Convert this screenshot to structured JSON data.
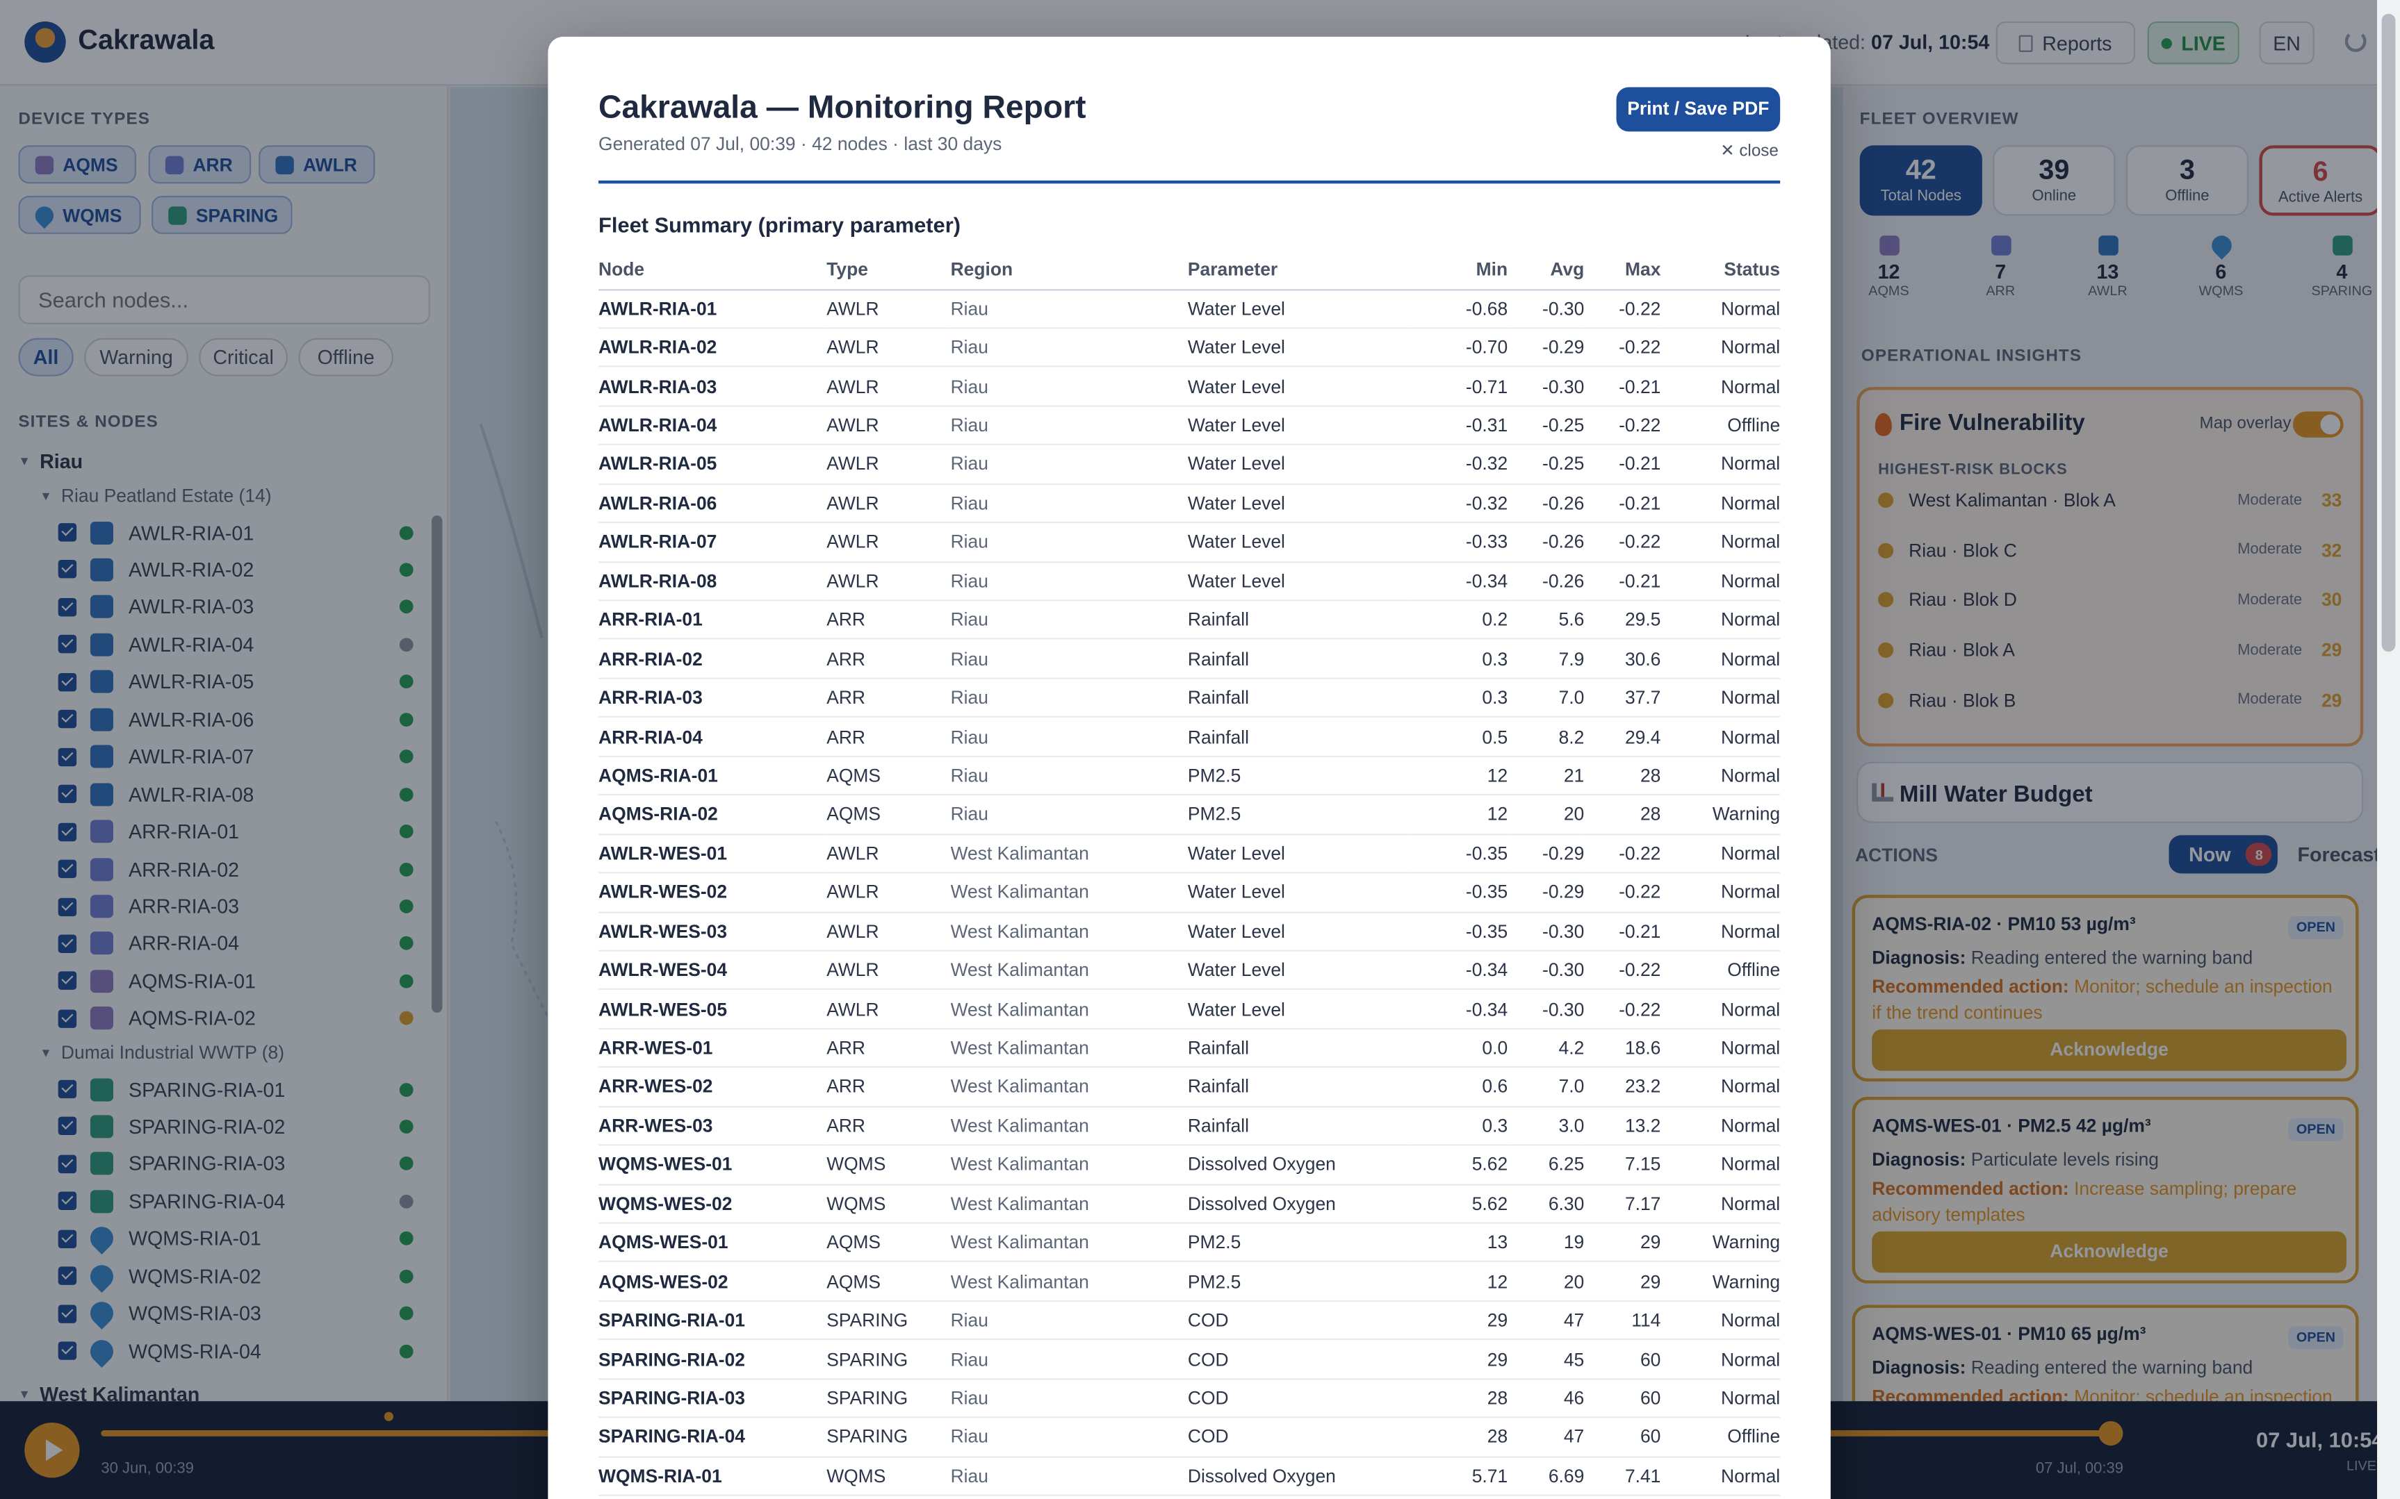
{
  "app": {
    "name": "Cakrawala",
    "last_updated_label": "Last updated:",
    "last_updated": "07 Jul, 10:54",
    "reports": "Reports",
    "live": "LIVE",
    "lang": "EN"
  },
  "left": {
    "device_types_label": "DEVICE TYPES",
    "device_types": [
      "AQMS",
      "ARR",
      "AWLR",
      "WQMS",
      "SPARING"
    ],
    "search_placeholder": "Search nodes...",
    "filters": [
      "All",
      "Warning",
      "Critical",
      "Offline"
    ],
    "tree_label": "SITES & NODES",
    "region1": "Riau",
    "site1": "Riau Peatland Estate (14)",
    "site1_nodes": [
      {
        "name": "AWLR-RIA-01",
        "type": "AWLR",
        "status": "ok"
      },
      {
        "name": "AWLR-RIA-02",
        "type": "AWLR",
        "status": "ok"
      },
      {
        "name": "AWLR-RIA-03",
        "type": "AWLR",
        "status": "ok"
      },
      {
        "name": "AWLR-RIA-04",
        "type": "AWLR",
        "status": "off"
      },
      {
        "name": "AWLR-RIA-05",
        "type": "AWLR",
        "status": "ok"
      },
      {
        "name": "AWLR-RIA-06",
        "type": "AWLR",
        "status": "ok"
      },
      {
        "name": "AWLR-RIA-07",
        "type": "AWLR",
        "status": "ok"
      },
      {
        "name": "AWLR-RIA-08",
        "type": "AWLR",
        "status": "ok"
      },
      {
        "name": "ARR-RIA-01",
        "type": "ARR",
        "status": "ok"
      },
      {
        "name": "ARR-RIA-02",
        "type": "ARR",
        "status": "ok"
      },
      {
        "name": "ARR-RIA-03",
        "type": "ARR",
        "status": "ok"
      },
      {
        "name": "ARR-RIA-04",
        "type": "ARR",
        "status": "ok"
      },
      {
        "name": "AQMS-RIA-01",
        "type": "AQMS",
        "status": "ok"
      },
      {
        "name": "AQMS-RIA-02",
        "type": "AQMS",
        "status": "warn"
      }
    ],
    "site2": "Dumai Industrial WWTP (8)",
    "site2_nodes": [
      {
        "name": "SPARING-RIA-01",
        "type": "SPARING",
        "status": "ok"
      },
      {
        "name": "SPARING-RIA-02",
        "type": "SPARING",
        "status": "ok"
      },
      {
        "name": "SPARING-RIA-03",
        "type": "SPARING",
        "status": "ok"
      },
      {
        "name": "SPARING-RIA-04",
        "type": "SPARING",
        "status": "off"
      },
      {
        "name": "WQMS-RIA-01",
        "type": "WQMS",
        "status": "ok"
      },
      {
        "name": "WQMS-RIA-02",
        "type": "WQMS",
        "status": "ok"
      },
      {
        "name": "WQMS-RIA-03",
        "type": "WQMS",
        "status": "ok"
      },
      {
        "name": "WQMS-RIA-04",
        "type": "WQMS",
        "status": "ok"
      }
    ],
    "region2": "West Kalimantan"
  },
  "right": {
    "fleet_label": "FLEET OVERVIEW",
    "tiles": [
      {
        "n": "42",
        "l": "Total Nodes"
      },
      {
        "n": "39",
        "l": "Online"
      },
      {
        "n": "3",
        "l": "Offline"
      },
      {
        "n": "6",
        "l": "Active Alerts"
      }
    ],
    "types": [
      {
        "n": "12",
        "l": "AQMS"
      },
      {
        "n": "7",
        "l": "ARR"
      },
      {
        "n": "13",
        "l": "AWLR"
      },
      {
        "n": "6",
        "l": "WQMS"
      },
      {
        "n": "4",
        "l": "SPARING"
      }
    ],
    "insights_label": "OPERATIONAL INSIGHTS",
    "fire_title": "Fire Vulnerability",
    "map_overlay": "Map overlay",
    "map_overlay_on": true,
    "risk_label": "HIGHEST-RISK BLOCKS",
    "blocks": [
      {
        "name": "West Kalimantan · Blok A",
        "level": "Moderate",
        "score": "33"
      },
      {
        "name": "Riau · Blok C",
        "level": "Moderate",
        "score": "32"
      },
      {
        "name": "Riau · Blok D",
        "level": "Moderate",
        "score": "30"
      },
      {
        "name": "Riau · Blok A",
        "level": "Moderate",
        "score": "29"
      },
      {
        "name": "Riau · Blok B",
        "level": "Moderate",
        "score": "29"
      }
    ],
    "mill_title": "Mill Water Budget",
    "actions_label": "ACTIONS",
    "now": "Now",
    "now_count": "8",
    "forecast": "Forecast",
    "diagnosis_label": "Diagnosis:",
    "rec_label": "Recommended action:",
    "open": "OPEN",
    "ack": "Acknowledge",
    "cards": [
      {
        "title": "AQMS-RIA-02 · PM10 53 µg/m³",
        "diag": "Reading entered the warning band",
        "rec": "Monitor; schedule an inspection if the trend continues"
      },
      {
        "title": "AQMS-WES-01 · PM2.5 42 µg/m³",
        "diag": "Particulate levels rising",
        "rec": "Increase sampling; prepare advisory templates"
      },
      {
        "title": "AQMS-WES-01 · PM10 65 µg/m³",
        "diag": "Reading entered the warning band",
        "rec": "Monitor; schedule an inspection if the trend continues"
      }
    ]
  },
  "timeline": {
    "start": "30 Jun, 00:39",
    "end": "07 Jul, 00:39",
    "now": "07 Jul, 10:54",
    "live": "LIVE",
    "progress": 1.0
  },
  "report": {
    "title": "Cakrawala — Monitoring Report",
    "subtitle": "Generated 07 Jul, 00:39 · 42 nodes · last 30 days",
    "print": "Print / Save PDF",
    "close": "close",
    "section": "Fleet Summary (primary parameter)",
    "columns": [
      "Node",
      "Type",
      "Region",
      "Parameter",
      "Min",
      "Avg",
      "Max",
      "Status"
    ],
    "rows": [
      [
        "AWLR-RIA-01",
        "AWLR",
        "Riau",
        "Water Level",
        "-0.68",
        "-0.30",
        "-0.22",
        "Normal"
      ],
      [
        "AWLR-RIA-02",
        "AWLR",
        "Riau",
        "Water Level",
        "-0.70",
        "-0.29",
        "-0.22",
        "Normal"
      ],
      [
        "AWLR-RIA-03",
        "AWLR",
        "Riau",
        "Water Level",
        "-0.71",
        "-0.30",
        "-0.21",
        "Normal"
      ],
      [
        "AWLR-RIA-04",
        "AWLR",
        "Riau",
        "Water Level",
        "-0.31",
        "-0.25",
        "-0.22",
        "Offline"
      ],
      [
        "AWLR-RIA-05",
        "AWLR",
        "Riau",
        "Water Level",
        "-0.32",
        "-0.25",
        "-0.21",
        "Normal"
      ],
      [
        "AWLR-RIA-06",
        "AWLR",
        "Riau",
        "Water Level",
        "-0.32",
        "-0.26",
        "-0.21",
        "Normal"
      ],
      [
        "AWLR-RIA-07",
        "AWLR",
        "Riau",
        "Water Level",
        "-0.33",
        "-0.26",
        "-0.22",
        "Normal"
      ],
      [
        "AWLR-RIA-08",
        "AWLR",
        "Riau",
        "Water Level",
        "-0.34",
        "-0.26",
        "-0.21",
        "Normal"
      ],
      [
        "ARR-RIA-01",
        "ARR",
        "Riau",
        "Rainfall",
        "0.2",
        "5.6",
        "29.5",
        "Normal"
      ],
      [
        "ARR-RIA-02",
        "ARR",
        "Riau",
        "Rainfall",
        "0.3",
        "7.9",
        "30.6",
        "Normal"
      ],
      [
        "ARR-RIA-03",
        "ARR",
        "Riau",
        "Rainfall",
        "0.3",
        "7.0",
        "37.7",
        "Normal"
      ],
      [
        "ARR-RIA-04",
        "ARR",
        "Riau",
        "Rainfall",
        "0.5",
        "8.2",
        "29.4",
        "Normal"
      ],
      [
        "AQMS-RIA-01",
        "AQMS",
        "Riau",
        "PM2.5",
        "12",
        "21",
        "28",
        "Normal"
      ],
      [
        "AQMS-RIA-02",
        "AQMS",
        "Riau",
        "PM2.5",
        "12",
        "20",
        "28",
        "Warning"
      ],
      [
        "AWLR-WES-01",
        "AWLR",
        "West Kalimantan",
        "Water Level",
        "-0.35",
        "-0.29",
        "-0.22",
        "Normal"
      ],
      [
        "AWLR-WES-02",
        "AWLR",
        "West Kalimantan",
        "Water Level",
        "-0.35",
        "-0.29",
        "-0.22",
        "Normal"
      ],
      [
        "AWLR-WES-03",
        "AWLR",
        "West Kalimantan",
        "Water Level",
        "-0.35",
        "-0.30",
        "-0.21",
        "Normal"
      ],
      [
        "AWLR-WES-04",
        "AWLR",
        "West Kalimantan",
        "Water Level",
        "-0.34",
        "-0.30",
        "-0.22",
        "Offline"
      ],
      [
        "AWLR-WES-05",
        "AWLR",
        "West Kalimantan",
        "Water Level",
        "-0.34",
        "-0.30",
        "-0.22",
        "Normal"
      ],
      [
        "ARR-WES-01",
        "ARR",
        "West Kalimantan",
        "Rainfall",
        "0.0",
        "4.2",
        "18.6",
        "Normal"
      ],
      [
        "ARR-WES-02",
        "ARR",
        "West Kalimantan",
        "Rainfall",
        "0.6",
        "7.0",
        "23.2",
        "Normal"
      ],
      [
        "ARR-WES-03",
        "ARR",
        "West Kalimantan",
        "Rainfall",
        "0.3",
        "3.0",
        "13.2",
        "Normal"
      ],
      [
        "WQMS-WES-01",
        "WQMS",
        "West Kalimantan",
        "Dissolved Oxygen",
        "5.62",
        "6.25",
        "7.15",
        "Normal"
      ],
      [
        "WQMS-WES-02",
        "WQMS",
        "West Kalimantan",
        "Dissolved Oxygen",
        "5.62",
        "6.30",
        "7.17",
        "Normal"
      ],
      [
        "AQMS-WES-01",
        "AQMS",
        "West Kalimantan",
        "PM2.5",
        "13",
        "19",
        "29",
        "Warning"
      ],
      [
        "AQMS-WES-02",
        "AQMS",
        "West Kalimantan",
        "PM2.5",
        "12",
        "20",
        "29",
        "Warning"
      ],
      [
        "SPARING-RIA-01",
        "SPARING",
        "Riau",
        "COD",
        "29",
        "47",
        "114",
        "Normal"
      ],
      [
        "SPARING-RIA-02",
        "SPARING",
        "Riau",
        "COD",
        "29",
        "45",
        "60",
        "Normal"
      ],
      [
        "SPARING-RIA-03",
        "SPARING",
        "Riau",
        "COD",
        "28",
        "46",
        "60",
        "Normal"
      ],
      [
        "SPARING-RIA-04",
        "SPARING",
        "Riau",
        "COD",
        "28",
        "47",
        "60",
        "Offline"
      ],
      [
        "WQMS-RIA-01",
        "WQMS",
        "Riau",
        "Dissolved Oxygen",
        "5.71",
        "6.69",
        "7.41",
        "Normal"
      ]
    ]
  },
  "colors": {
    "primary": "#1d4f9c",
    "accent": "#e8951f",
    "ok": "#22a052",
    "warn": "#e0a12a",
    "off": "#8d95a3",
    "alert": "#d44b4b"
  },
  "icons": {
    "AQMS": "wind-icon",
    "ARR": "rain-icon",
    "AWLR": "wave-icon",
    "WQMS": "droplet-icon",
    "SPARING": "factory-icon"
  }
}
